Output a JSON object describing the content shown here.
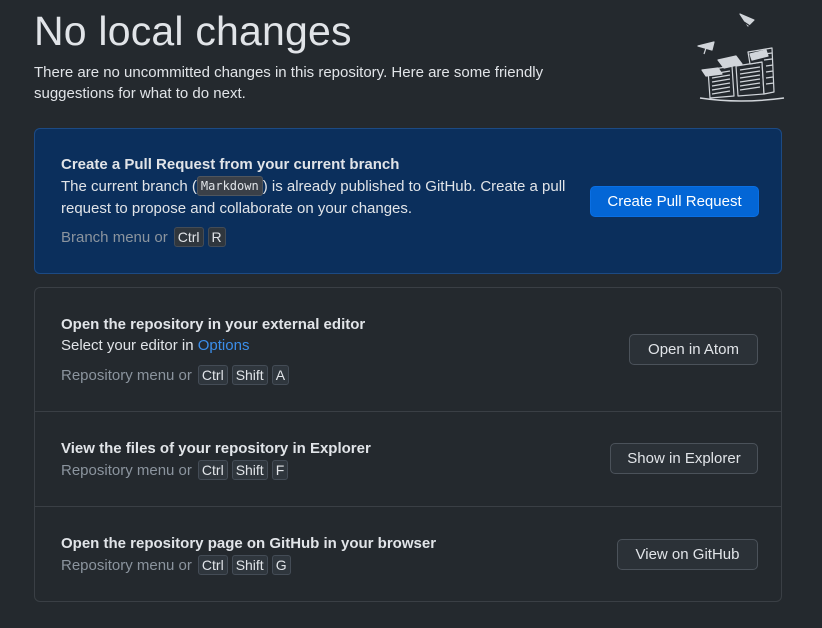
{
  "header": {
    "title": "No local changes",
    "subtitle": "There are no uncommitted changes in this repository. Here are some friendly suggestions for what to do next."
  },
  "pull_request": {
    "title": "Create a Pull Request from your current branch",
    "desc_before": "The current branch (",
    "branch": "Markdown",
    "desc_after": ") is already published to GitHub. Create a pull request to propose and collaborate on your changes.",
    "shortcut_prefix": "Branch menu or",
    "keys": [
      "Ctrl",
      "R"
    ],
    "button_label": "Create Pull Request"
  },
  "suggestions": [
    {
      "title": "Open the repository in your external editor",
      "desc_prefix": "Select your editor in ",
      "link_label": "Options",
      "shortcut_prefix": "Repository menu or",
      "keys": [
        "Ctrl",
        "Shift",
        "A"
      ],
      "button_label": "Open in Atom"
    },
    {
      "title": "View the files of your repository in Explorer",
      "shortcut_prefix": "Repository menu or",
      "keys": [
        "Ctrl",
        "Shift",
        "F"
      ],
      "button_label": "Show in Explorer"
    },
    {
      "title": "Open the repository page on GitHub in your browser",
      "shortcut_prefix": "Repository menu or",
      "keys": [
        "Ctrl",
        "Shift",
        "G"
      ],
      "button_label": "View on GitHub"
    }
  ],
  "colors": {
    "background": "#24292e",
    "primary_card": "#0b2f5c",
    "primary_button": "#0366d6",
    "link": "#3b8eea"
  },
  "icons": {
    "illustration": "paper-stack-illustration-icon"
  }
}
